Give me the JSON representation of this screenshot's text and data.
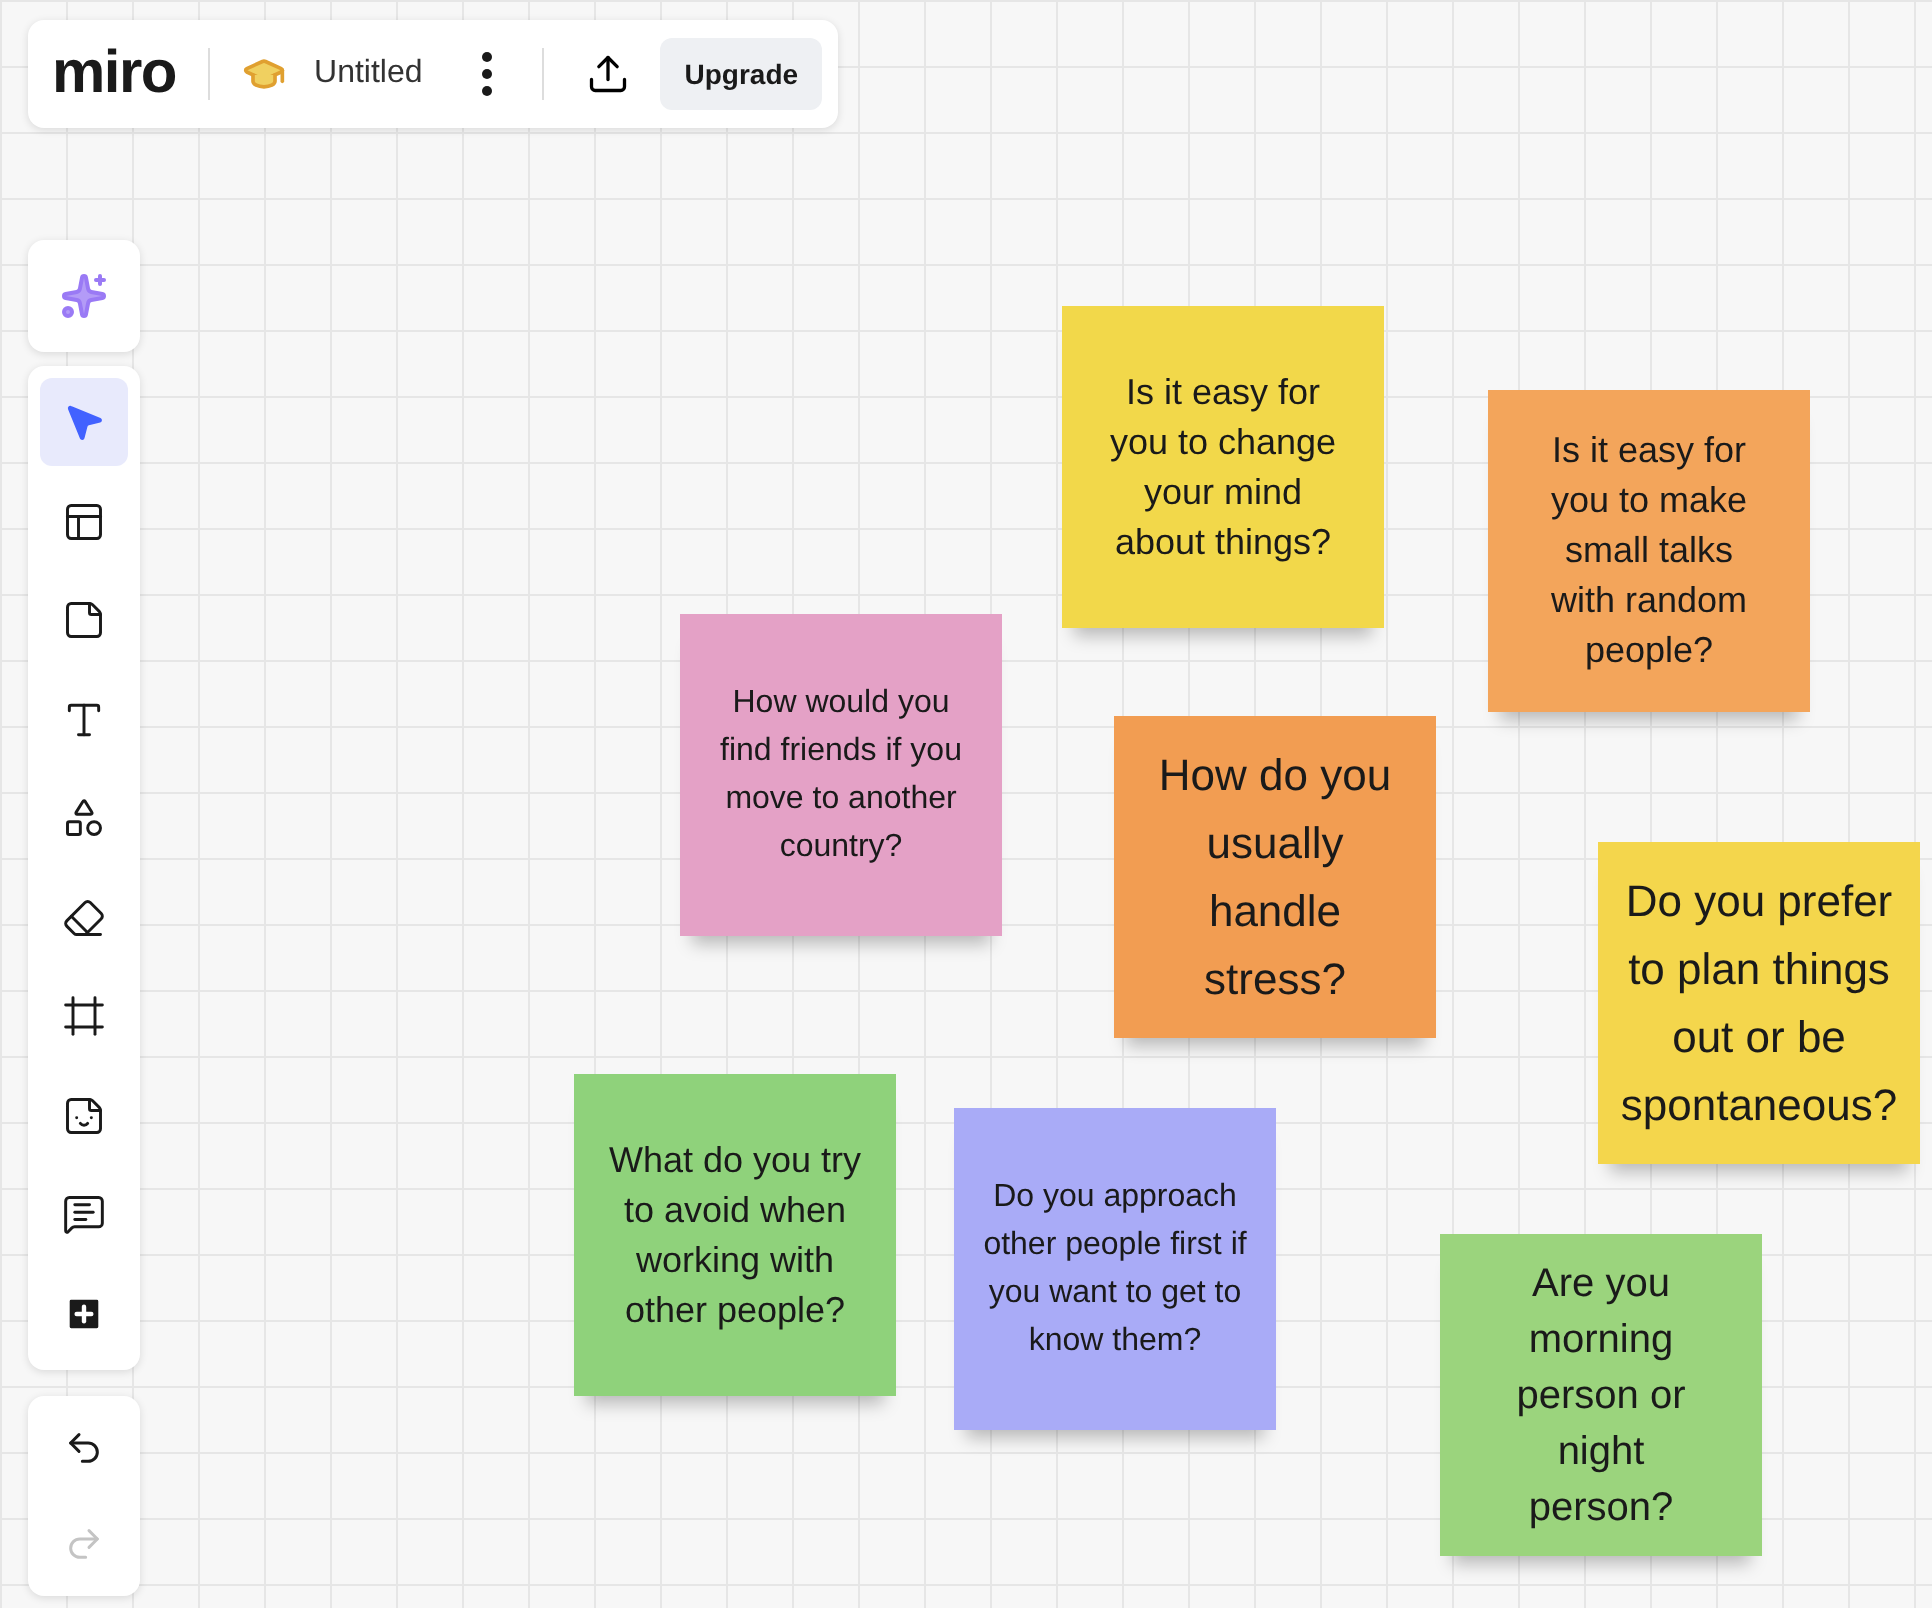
{
  "topbar": {
    "logo": "miro",
    "board_title": "Untitled",
    "upgrade_button": "Upgrade"
  },
  "tools": [
    {
      "kind": "ai",
      "selected": false
    },
    {
      "kind": "select",
      "selected": true
    },
    {
      "kind": "templates",
      "selected": false
    },
    {
      "kind": "sticky",
      "selected": false
    },
    {
      "kind": "text",
      "selected": false
    },
    {
      "kind": "shapes",
      "selected": false
    },
    {
      "kind": "eraser",
      "selected": false
    },
    {
      "kind": "frame",
      "selected": false
    },
    {
      "kind": "sticker",
      "selected": false
    },
    {
      "kind": "comment",
      "selected": false
    },
    {
      "kind": "more",
      "selected": false
    }
  ],
  "history": [
    {
      "kind": "undo",
      "disabled": false
    },
    {
      "kind": "redo",
      "disabled": true
    }
  ],
  "sticky_notes": [
    {
      "text": "Is it easy for you to change your mind about things?",
      "color": "#f2d84a"
    },
    {
      "text": "Is it easy for you to make small talks with random people?",
      "color": "#f3a55b"
    },
    {
      "text": "How would you find friends if you move to another country?",
      "color": "#e4a1c6"
    },
    {
      "text": "How do you usually handle stress?",
      "color": "#f29d52"
    },
    {
      "text": "Do you prefer to plan things out or be spontaneous?",
      "color": "#f4d64c"
    },
    {
      "text": "What do you try to avoid when working with other people?",
      "color": "#8fd27b"
    },
    {
      "text": "Do you approach other people first if you want to get to know them?",
      "color": "#a9abf7"
    },
    {
      "text": "Are you morning person or night person?",
      "color": "#9bd47d"
    }
  ]
}
